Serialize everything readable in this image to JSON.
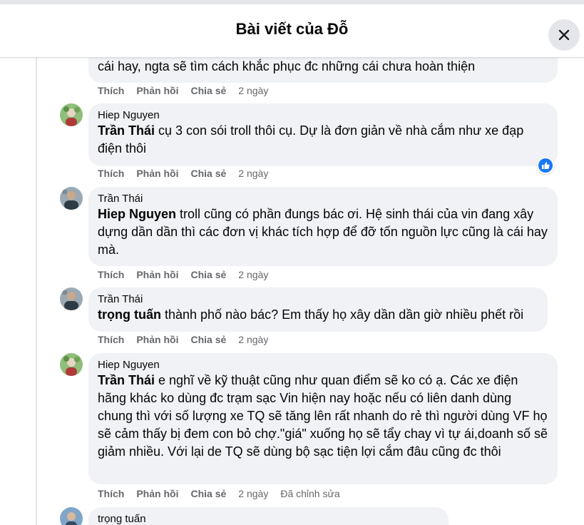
{
  "header": {
    "title": "Bài viết của Đỗ"
  },
  "actions": {
    "like": "Thích",
    "reply": "Phản hồi",
    "share": "Chia sẻ"
  },
  "comments": [
    {
      "author": "",
      "mention": "",
      "text": "cái hay, ngta sẽ tìm cách khắc phục đc những cái chưa hoàn thiện",
      "time": "2 ngày",
      "edited": ""
    },
    {
      "author": "Hiep Nguyen",
      "mention": "Trần Thái",
      "text": " cụ 3 con sói troll thôi cụ. Dự là đơn giản về nhà cắm như xe đạp điện thôi",
      "time": "2 ngày",
      "edited": "",
      "reaction": "like-icon"
    },
    {
      "author": "Trần Thái",
      "mention": "Hiep Nguyen",
      "text": " troll cũng có phần đungs bác ơi. Hệ sinh thái của vin đang xây dựng dần dần thì các đơn vị khác tích hợp để đỡ tốn nguồn lực cũng là cái hay mà.",
      "time": "2 ngày",
      "edited": ""
    },
    {
      "author": "Trần Thái",
      "mention": "trọng tuấn",
      "text": " thành phố nào bác? Em thấy họ xây dần dần giờ nhiều phết rồi",
      "time": "2 ngày",
      "edited": ""
    },
    {
      "author": "Hiep Nguyen",
      "mention": "Trần Thái",
      "text": " e nghĩ về kỹ thuật cũng như quan điểm sẽ ko có ạ. Các xe điện hãng khác ko dùng đc trạm sạc Vin hiện nay hoặc nếu có liên danh dùng chung thì với số lượng xe TQ sẽ tăng lên rất nhanh do rẻ thì người dùng VF họ sẽ cảm thấy bị đem con bỏ chợ.\"giá\" xuống họ sẽ tẩy chay vì tự ái,doanh số sẽ giảm nhiều. Với lại de TQ sẽ dùng bộ sạc tiện lợi cắm đâu cũng đc thôi",
      "time": "2 ngày",
      "edited": "Đã chỉnh sửa"
    },
    {
      "author": "trọng tuấn",
      "mention": "",
      "text": "",
      "time": "",
      "edited": ""
    }
  ],
  "colors": {
    "bubble": "#f0f2f5",
    "meta": "#65676b",
    "like": "#1877f2"
  }
}
